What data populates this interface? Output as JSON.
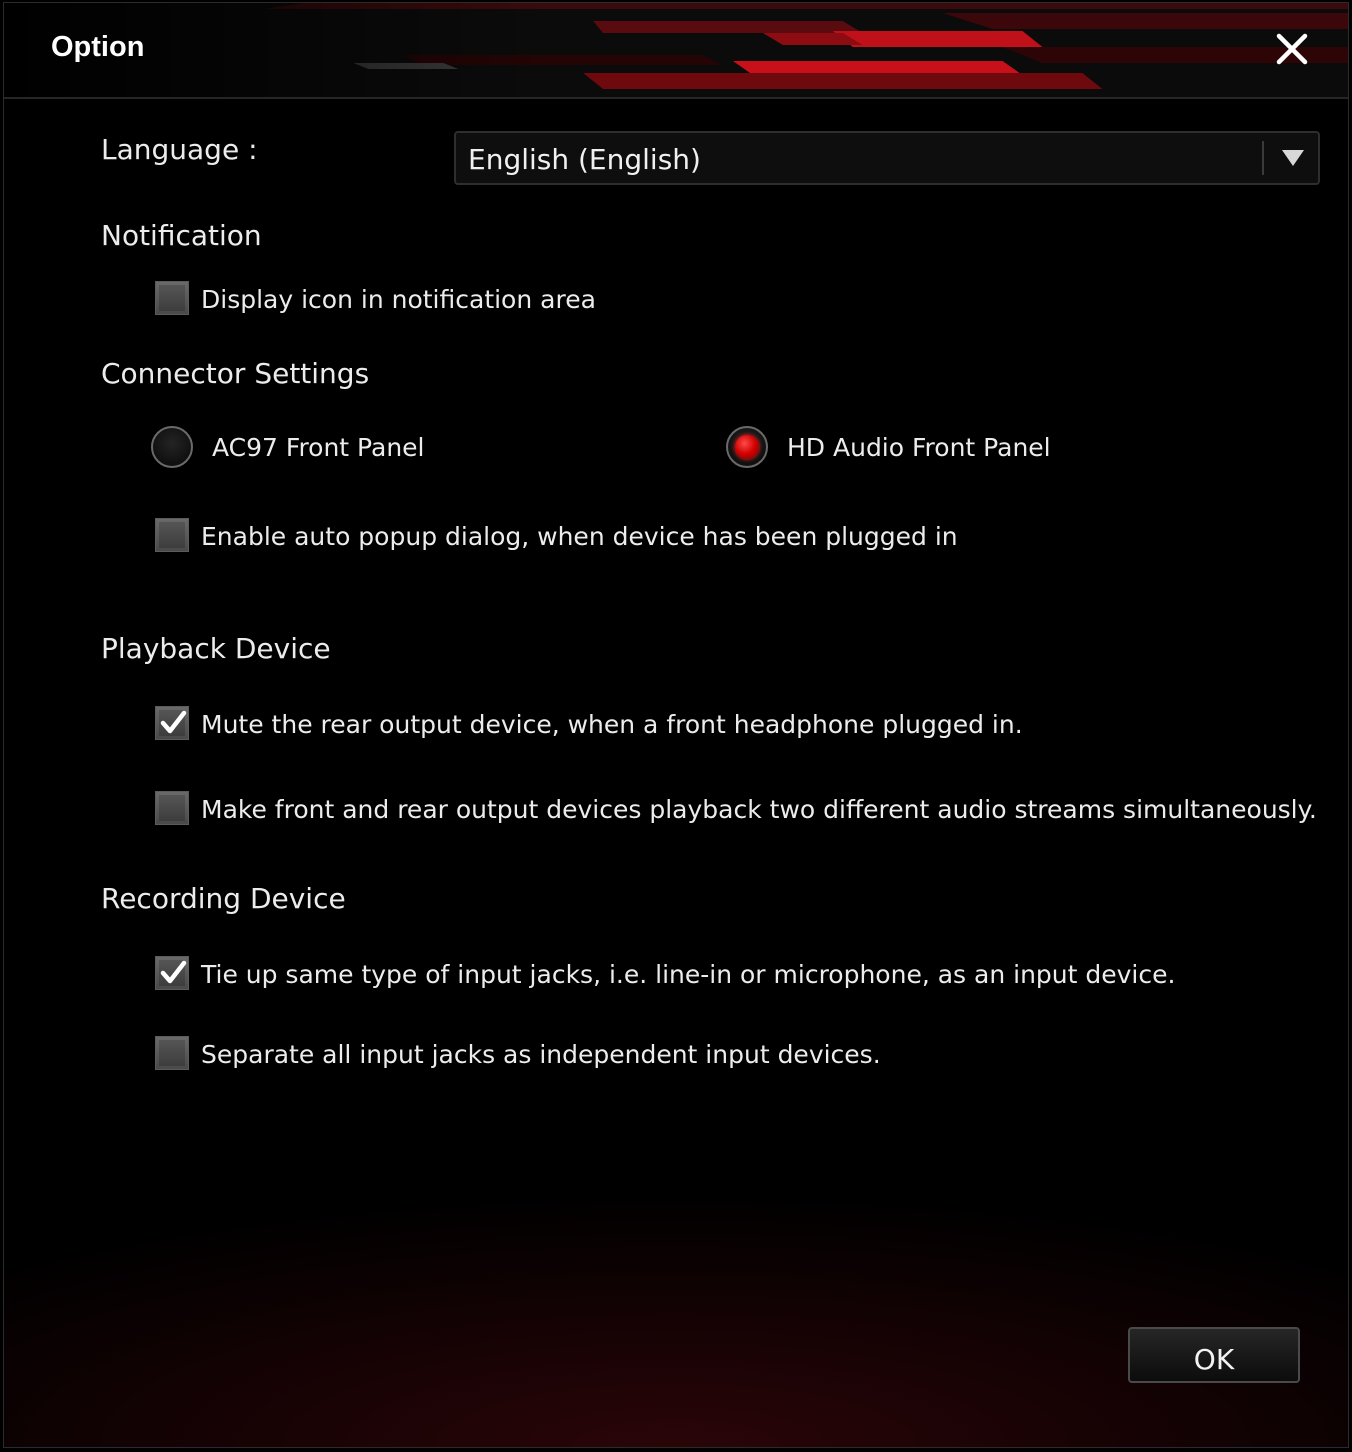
{
  "window": {
    "title": "Option"
  },
  "language": {
    "label": "Language :",
    "selected": "English (English)"
  },
  "notification": {
    "heading": "Notification",
    "display_icon": {
      "label": "Display icon in notification area",
      "checked": false
    }
  },
  "connector": {
    "heading": "Connector Settings",
    "options": [
      {
        "label": "AC97 Front Panel",
        "selected": false
      },
      {
        "label": "HD Audio Front Panel",
        "selected": true
      }
    ],
    "auto_popup": {
      "label": "Enable auto popup dialog, when device has been plugged in",
      "checked": false
    }
  },
  "playback": {
    "heading": "Playback Device",
    "mute_rear": {
      "label": "Mute the rear output device, when a front headphone plugged in.",
      "checked": true
    },
    "two_streams": {
      "label": "Make front and rear output devices playback two different audio streams simultaneously.",
      "checked": false
    }
  },
  "recording": {
    "heading": "Recording Device",
    "tie_up": {
      "label": "Tie up same type of input jacks, i.e. line-in or microphone, as an input device.",
      "checked": true
    },
    "separate": {
      "label": "Separate all input jacks as independent input devices.",
      "checked": false
    }
  },
  "buttons": {
    "ok": "OK"
  },
  "colors": {
    "accent": "#d00000",
    "background": "#000000"
  },
  "icons": {
    "close": "close-icon",
    "dropdown": "triangle-down-icon",
    "check": "checkmark-icon"
  }
}
